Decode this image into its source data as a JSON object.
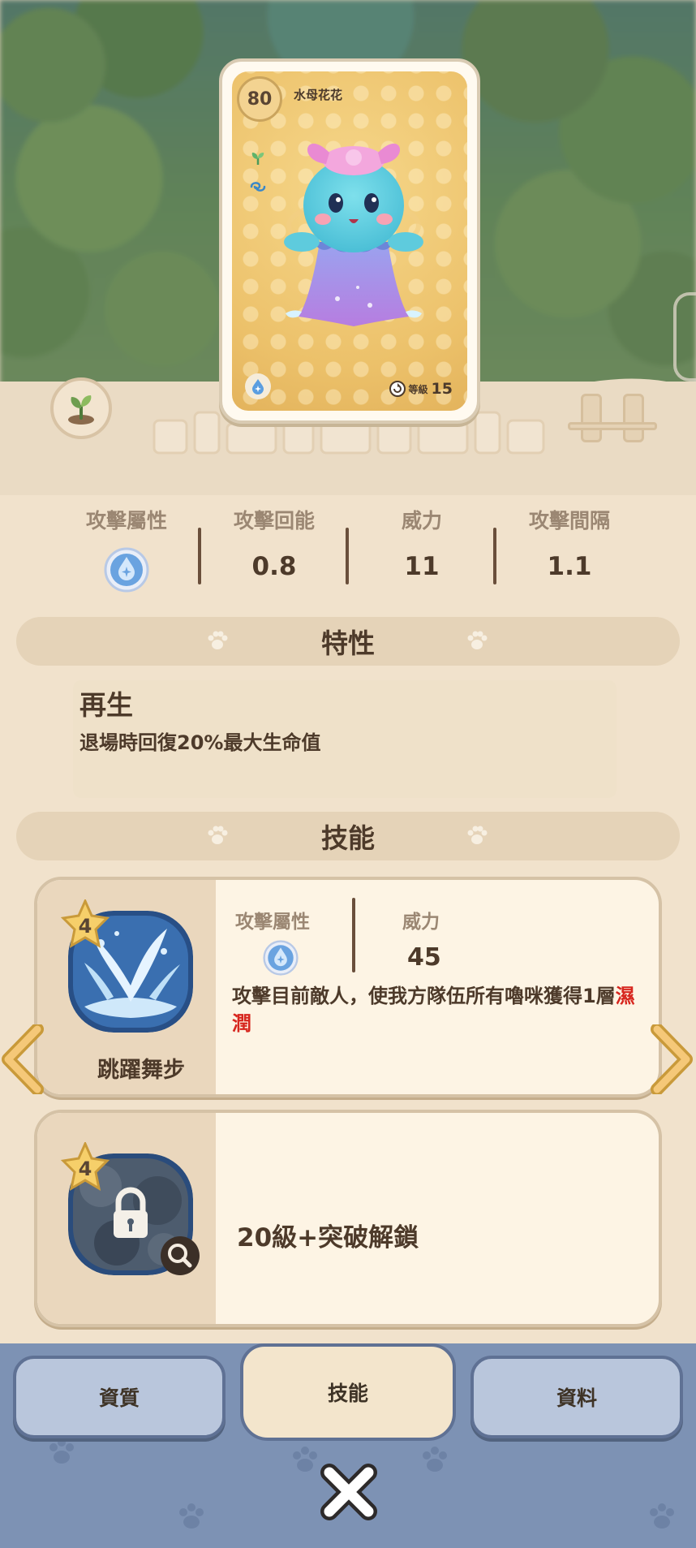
{
  "card": {
    "level": "80",
    "name": "水母花花",
    "grade_label": "等級",
    "grade": "15"
  },
  "stats": [
    {
      "label": "攻擊屬性",
      "value": "",
      "icon": "water-element-icon"
    },
    {
      "label": "攻擊回能",
      "value": "0.8"
    },
    {
      "label": "威力",
      "value": "11"
    },
    {
      "label": "攻擊間隔",
      "value": "1.1"
    }
  ],
  "trait_section": {
    "title": "特性"
  },
  "trait": {
    "name": "再生",
    "description": "退場時回復20%最大生命值"
  },
  "skill_section": {
    "title": "技能"
  },
  "skills": [
    {
      "star": "4",
      "name": "跳躍舞步",
      "element_label": "攻擊屬性",
      "element_icon": "water-element-icon",
      "power_label": "威力",
      "power": "45",
      "description": "攻擊目前敵人，使我方隊伍所有嚕咪獲得1層",
      "highlight": "濕潤",
      "highlight_color": "#d7261e"
    },
    {
      "star": "4",
      "locked": true,
      "unlock_text": "20級+突破解鎖"
    }
  ],
  "tabs": [
    {
      "label": "資質",
      "active": false
    },
    {
      "label": "技能",
      "active": true
    },
    {
      "label": "資料",
      "active": false
    }
  ],
  "colors": {
    "accent_water": "#6aa3e0",
    "bottom_bar": "#7d92b4",
    "cream": "#f1e2cc"
  }
}
